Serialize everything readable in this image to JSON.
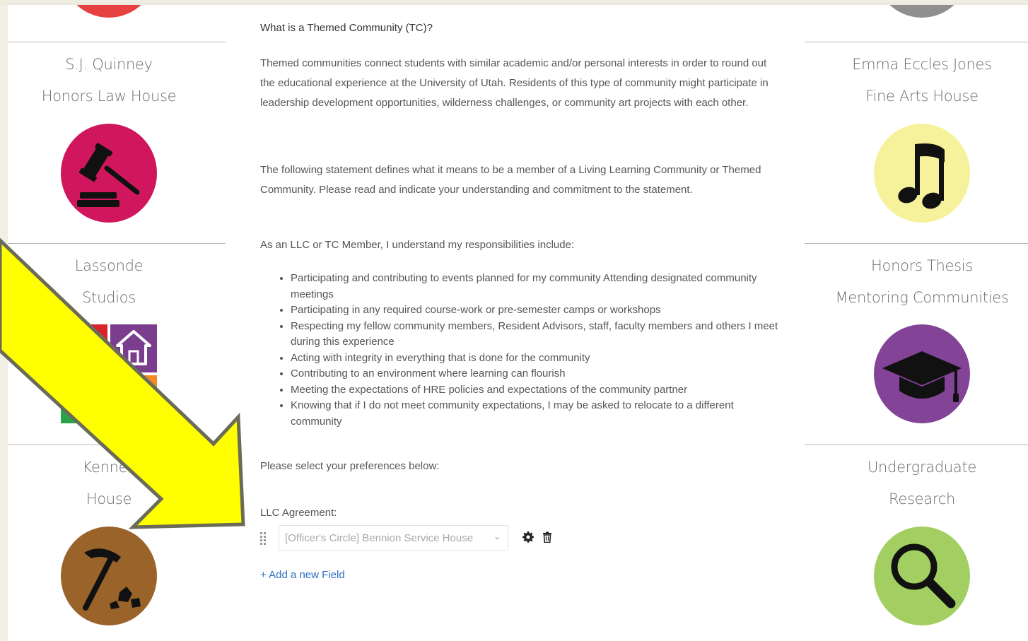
{
  "left_column": [
    {
      "line1": "S.J. Quinney",
      "line2": "Honors Law House",
      "icon": "gavel-icon",
      "color": "#d0175e"
    },
    {
      "line1": "Lassonde",
      "line2": "Studios",
      "icon": "house-blocks-icon",
      "color": "#7b3d8e"
    },
    {
      "line1": "Kennec",
      "line2": "House",
      "icon": "hammer-rocks-icon",
      "color": "#9a6329"
    }
  ],
  "right_column": [
    {
      "line1": "Emma Eccles Jones",
      "line2": "Fine Arts House",
      "icon": "music-note-icon",
      "color": "#f6f29b"
    },
    {
      "line1": "Honors Thesis",
      "line2": "Mentoring Communities",
      "icon": "graduation-cap-icon",
      "color": "#834397"
    },
    {
      "line1": "Undergraduate",
      "line2": "Research",
      "icon": "magnifier-icon",
      "color": "#a3cf62"
    }
  ],
  "main": {
    "question": "What is a Themed Community (TC)?",
    "intro": "Themed communities connect students with similar academic and/or personal interests in order to round out the educational experience at the University of Utah. Residents of this type of community might participate in leadership development opportunities, wilderness challenges, or community art projects with each other.",
    "statement": "The following statement defines what it means to be a member of a Living Learning Community or Themed Community. Please read and indicate your understanding and commitment to the statement.",
    "resp_heading": "As an LLC or TC Member, I understand my responsibilities include:",
    "responsibilities": [
      "Participating and contributing to events planned for my community Attending designated community meetings",
      "Participating in any required course-work or pre-semester camps or workshops",
      "Respecting my fellow community members, Resident Advisors, staff, faculty members and others I meet during this experience",
      "Acting with integrity in everything that is done for the community",
      "Contributing to an environment where learning can flourish",
      "Meeting the expectations of HRE policies and expectations of the community partner",
      "Knowing that if I do not meet community expectations, I may be asked to relocate to a different community"
    ],
    "preferences_prompt": "Please select your preferences below:",
    "field_label": "LLC Agreement:",
    "select_value": "[Officer's Circle] Bennion Service House",
    "add_field": "+ Add a new Field"
  },
  "colors": {
    "arrow_fill": "#ffff00",
    "arrow_stroke": "#6b6b57",
    "link": "#2a6fc0"
  }
}
